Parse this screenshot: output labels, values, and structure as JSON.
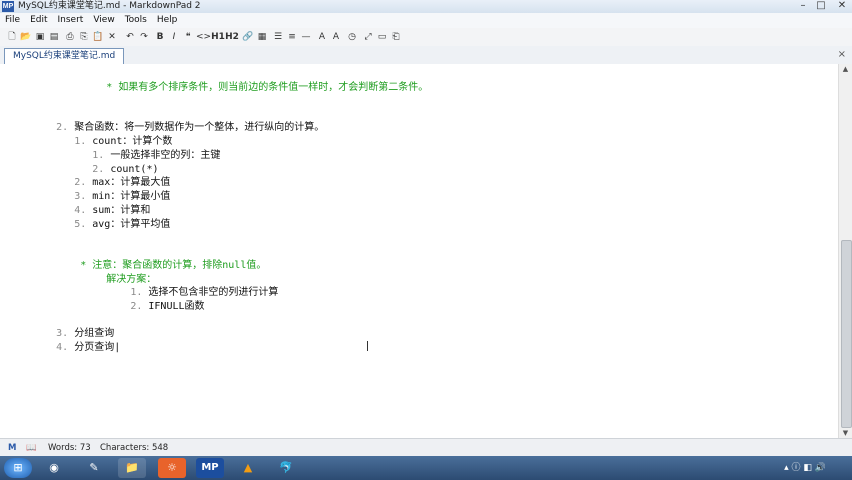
{
  "window": {
    "title": "MySQL约束课堂笔记.md - MarkdownPad 2",
    "app_badge": "MP"
  },
  "menu": [
    "File",
    "Edit",
    "Insert",
    "View",
    "Tools",
    "Help"
  ],
  "toolbar": {
    "h1": "H1",
    "h2": "H2",
    "quote": "❝",
    "code": "<>"
  },
  "tab": {
    "label": "MySQL约束课堂笔记.md",
    "close": "×"
  },
  "document": {
    "lines": [
      {
        "indent": "        ",
        "bullet": "* ",
        "text": "如果有多个排序条件，则当前边的条件值一样时，才会判断第二条件。",
        "style": "green"
      },
      {
        "indent": "  ",
        "bullet": "2. ",
        "text": "聚合函数：将一列数据作为一个整体，进行纵向的计算。"
      },
      {
        "indent": "     ",
        "bullet": "1. ",
        "text": "count：计算个数"
      },
      {
        "indent": "        ",
        "bullet": "1. ",
        "text": "一般选择非空的列：主键"
      },
      {
        "indent": "        ",
        "bullet": "2. ",
        "text": "count(*)"
      },
      {
        "indent": "     ",
        "bullet": "2. ",
        "text": "max：计算最大值"
      },
      {
        "indent": "     ",
        "bullet": "3. ",
        "text": "min：计算最小值"
      },
      {
        "indent": "     ",
        "bullet": "4. ",
        "text": "sum：计算和"
      },
      {
        "indent": "     ",
        "bullet": "5. ",
        "text": "avg：计算平均值"
      },
      {
        "indent": "      ",
        "bullet": "* ",
        "text": "注意：聚合函数的计算，排除null值。",
        "style": "green"
      },
      {
        "indent": "        ",
        "bullet": "",
        "text": "解决方案：",
        "style": "green"
      },
      {
        "indent": "           ",
        "bullet": "1. ",
        "text": "选择不包含非空的列进行计算"
      },
      {
        "indent": "           ",
        "bullet": "2. ",
        "text": "IFNULL函数"
      },
      {
        "indent": "  ",
        "bullet": "3. ",
        "text": "分组查询"
      },
      {
        "indent": "  ",
        "bullet": "4. ",
        "text": "分页查询"
      }
    ]
  },
  "status": {
    "words": "Words: 73",
    "characters": "Characters: 548"
  }
}
